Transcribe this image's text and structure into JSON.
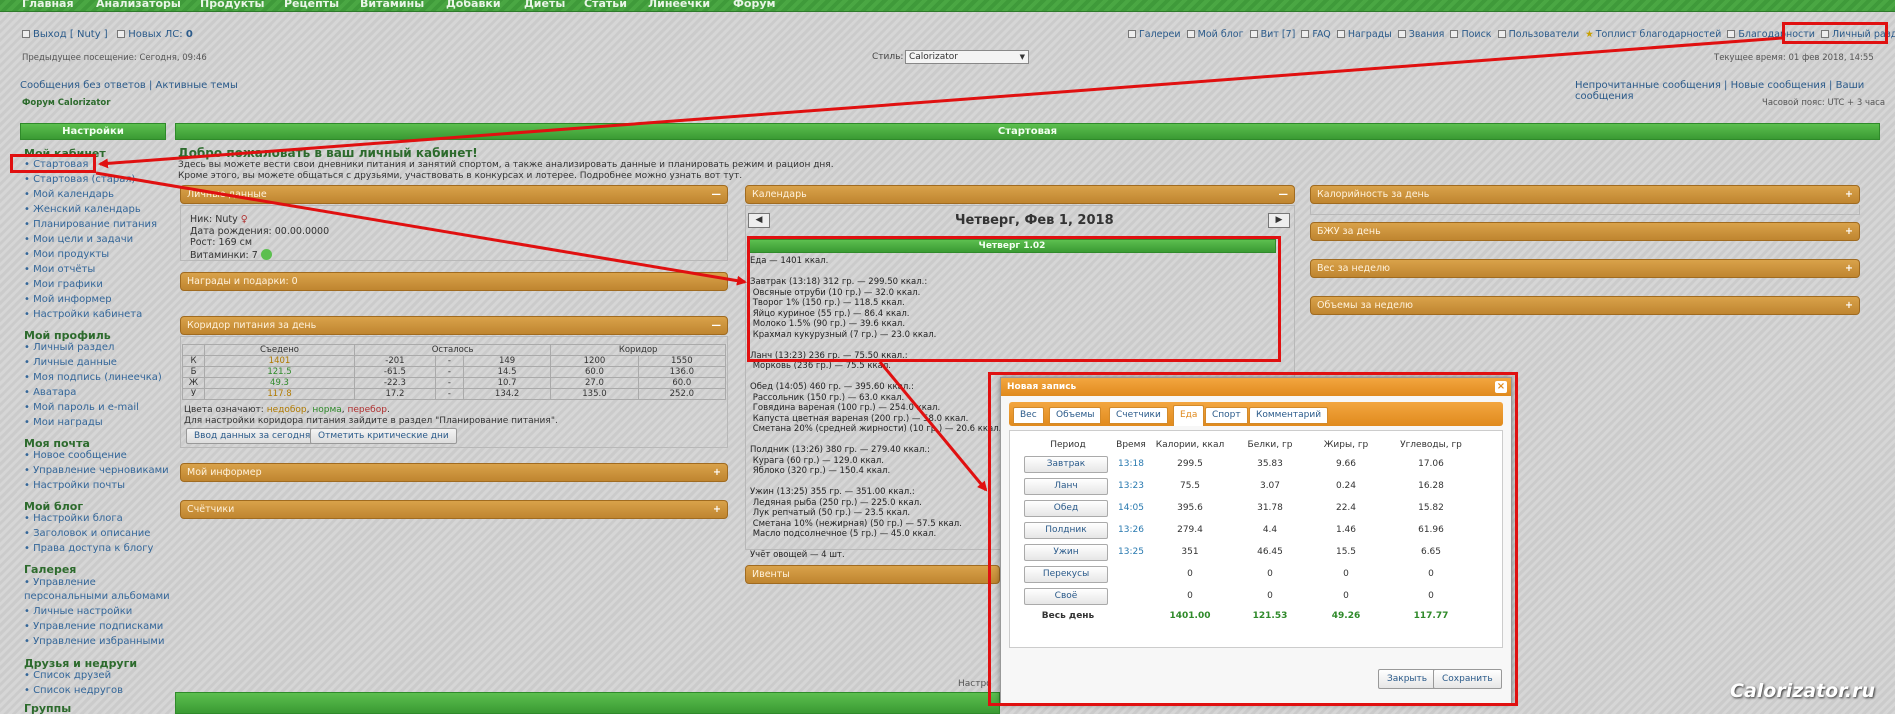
{
  "topnav": [
    "Главная",
    "Анализаторы",
    "Продукты",
    "Рецепты",
    "Витамины",
    "Добавки",
    "Диеты",
    "Статьи",
    "Линеечки",
    "Форум"
  ],
  "header": {
    "logout": "Выход [ Nuty ]",
    "new_pm": "Новых ЛС:",
    "new_pm_count": "0",
    "links": [
      "Галереи",
      "Мой блог",
      "Вит [7]",
      "FAQ",
      "Награды",
      "Звания",
      "Поиск",
      "Пользователи",
      "Топлист благодарностей",
      "Благодарности",
      "Личный раздел"
    ],
    "prev_visit": "Предыдущее посещение: Сегодня, 09:46",
    "style_label": "Стиль:",
    "style_value": "Calorizator",
    "current_time": "Текущее время: 01 фев 2018, 14:55",
    "left_links": "Сообщения без ответов | Активные темы",
    "right_links": "Непрочитанные сообщения | Новые сообщения | Ваши сообщения",
    "forum_name": "Форум Calorizator",
    "timezone": "Часовой пояс: UTC + 3 часа"
  },
  "sidebar": {
    "title": "Настройки",
    "sections": [
      {
        "heading": "Мой кабинет",
        "items": [
          "Стартовая",
          "Стартовая (старая)",
          "Мой календарь",
          "Женский календарь",
          "Планирование питания",
          "Мои цели и задачи",
          "Мои продукты",
          "Мои отчёты",
          "Мои графики",
          "Мой информер",
          "Настройки кабинета"
        ]
      },
      {
        "heading": "Мой профиль",
        "items": [
          "Личный раздел",
          "Личные данные",
          "Моя подпись (линеечка)",
          "Аватара",
          "Мой пароль и e-mail",
          "Мои награды"
        ]
      },
      {
        "heading": "Моя почта",
        "items": [
          "Новое сообщение",
          "Управление черновиками",
          "Настройки почты"
        ]
      },
      {
        "heading": "Мой блог",
        "items": [
          "Настройки блога",
          "Заголовок и описание",
          "Права доступа к блогу"
        ]
      },
      {
        "heading": "Галерея",
        "items": [
          "Управление персональными альбомами",
          "Личные настройки",
          "Управление подписками",
          "Управление избранными"
        ]
      },
      {
        "heading": "Друзья и недруги",
        "items": [
          "Список друзей",
          "Список недругов"
        ]
      },
      {
        "heading": "Группы",
        "items": []
      }
    ]
  },
  "main": {
    "title": "Стартовая",
    "welcome": "Добро пожаловать в ваш личный кабинет!",
    "intro1": "Здесь вы можете вести свои дневники питания и занятий спортом, а также анализировать данные и планировать режим и рацион дня.",
    "intro2": "Кроме этого, вы можете общаться с друзьями, участвовать в конкурсах и лотерее. Подробнее можно узнать вот тут.",
    "personal_panel": "Личные данные",
    "nick": "Ник: Nuty",
    "birth": "Дата рождения: 00.00.0000",
    "height": "Рост: 169 см",
    "vitamins": "Витаминки: 7",
    "awards_panel": "Награды и подарки: 0",
    "corridor_panel": "Коридор питания за день",
    "corridor": {
      "headers": [
        "",
        "Съедено",
        "Осталось",
        "Коридор"
      ],
      "rows": [
        {
          "k": "К",
          "eaten": "1401",
          "left1": "-201",
          "sep": "-",
          "left2": "149",
          "c1": "1200",
          "c2": "1550"
        },
        {
          "k": "Б",
          "eaten": "121.5",
          "left1": "-61.5",
          "sep": "-",
          "left2": "14.5",
          "c1": "60.0",
          "c2": "136.0"
        },
        {
          "k": "Ж",
          "eaten": "49.3",
          "left1": "-22.3",
          "sep": "-",
          "left2": "10.7",
          "c1": "27.0",
          "c2": "60.0"
        },
        {
          "k": "У",
          "eaten": "117.8",
          "left1": "17.2",
          "sep": "-",
          "left2": "134.2",
          "c1": "135.0",
          "c2": "252.0"
        }
      ]
    },
    "legend_prefix": "Цвета означают:",
    "legend_under": "недобор",
    "legend_norm": "норма",
    "legend_over": "перебор",
    "corridor_note": "Для настройки коридора питания зайдите в раздел \"Планирование питания\".",
    "btn_enter": "Ввод данных за сегодня",
    "btn_critical": "Отметить критические дни",
    "informer_panel": "Мой информер",
    "counters_panel": "Счётчики",
    "calendar_panel": "Календарь",
    "calendar_date": "Четверг, Фев 1, 2018",
    "day_header": "Четверг 1.02",
    "diary_text": "Еда — 1401 ккал.\n\nЗавтрак (13:18) 312 гр. — 299.50 ккал.:\n Овсяные отруби (10 гр.) — 32.0 ккал.\n Творог 1% (150 гр.) — 118.5 ккал.\n Яйцо куриное (55 гр.) — 86.4 ккал.\n Молоко 1.5% (90 гр.) — 39.6 ккал.\n Крахмал кукурузный (7 гр.) — 23.0 ккал.\n\nЛанч (13:23) 236 гр. — 75.50 ккал.:\n Морковь (236 гр.) — 75.5 ккал.\n\nОбед (14:05) 460 гр. — 395.60 ккал.:\n Рассольник (150 гр.) — 63.0 ккал.\n Говядина вареная (100 гр.) — 254.0 ккал.\n Капуста цветная вареная (200 гр.) — 58.0 ккал.\n Сметана 20% (средней жирности) (10 гр.) — 20.6 ккал.\n\nПолдник (13:26) 380 гр. — 279.40 ккал.:\n Курага (60 гр.) — 129.0 ккал.\n Яблоко (320 гр.) — 150.4 ккал.\n\nУжин (13:25) 355 гр. — 351.00 ккал.:\n Ледяная рыба (250 гр.) — 225.0 ккал.\n Лук репчатый (50 гр.) — 23.5 ккал.\n Сметана 10% (нежирная) (50 гр.) — 57.5 ккал.\n Масло подсолнечное (5 гр.) — 45.0 ккал.\n\nУчёт овощей — 4 шт.",
    "events_panel": "Ивенты",
    "right_panels": [
      "Калорийность за день",
      "БЖУ за день",
      "Вес за неделю",
      "Объемы за неделю"
    ],
    "footer_partial": "Настро"
  },
  "modal": {
    "title": "Новая запись",
    "close": "×",
    "tabs": [
      "Вес",
      "Объемы",
      "Счетчики",
      "Еда",
      "Спорт",
      "Комментарий"
    ],
    "active_tab": "Еда",
    "headers": [
      "Период",
      "Время",
      "Калории, ккал",
      "Белки, гр",
      "Жиры, гр",
      "Углеводы, гр"
    ],
    "rows": [
      {
        "period": "Завтрак",
        "time": "13:18",
        "kcal": "299.5",
        "protein": "35.83",
        "fat": "9.66",
        "carbs": "17.06"
      },
      {
        "period": "Ланч",
        "time": "13:23",
        "kcal": "75.5",
        "protein": "3.07",
        "fat": "0.24",
        "carbs": "16.28"
      },
      {
        "period": "Обед",
        "time": "14:05",
        "kcal": "395.6",
        "protein": "31.78",
        "fat": "22.4",
        "carbs": "15.82"
      },
      {
        "period": "Полдник",
        "time": "13:26",
        "kcal": "279.4",
        "protein": "4.4",
        "fat": "1.46",
        "carbs": "61.96"
      },
      {
        "period": "Ужин",
        "time": "13:25",
        "kcal": "351",
        "protein": "46.45",
        "fat": "15.5",
        "carbs": "6.65"
      },
      {
        "period": "Перекусы",
        "time": "",
        "kcal": "0",
        "protein": "0",
        "fat": "0",
        "carbs": "0"
      },
      {
        "period": "Своё",
        "time": "",
        "kcal": "0",
        "protein": "0",
        "fat": "0",
        "carbs": "0"
      }
    ],
    "total": {
      "label": "Весь день",
      "kcal": "1401.00",
      "protein": "121.53",
      "fat": "49.26",
      "carbs": "117.77"
    },
    "btn_close": "Закрыть",
    "btn_save": "Сохранить"
  },
  "watermark": "Calorizator.ru",
  "colors": {
    "annotation_red": "#e01010",
    "brand_green": "#3a9a33",
    "panel_orange": "#c98c35",
    "modal_orange": "#e08a1d"
  }
}
